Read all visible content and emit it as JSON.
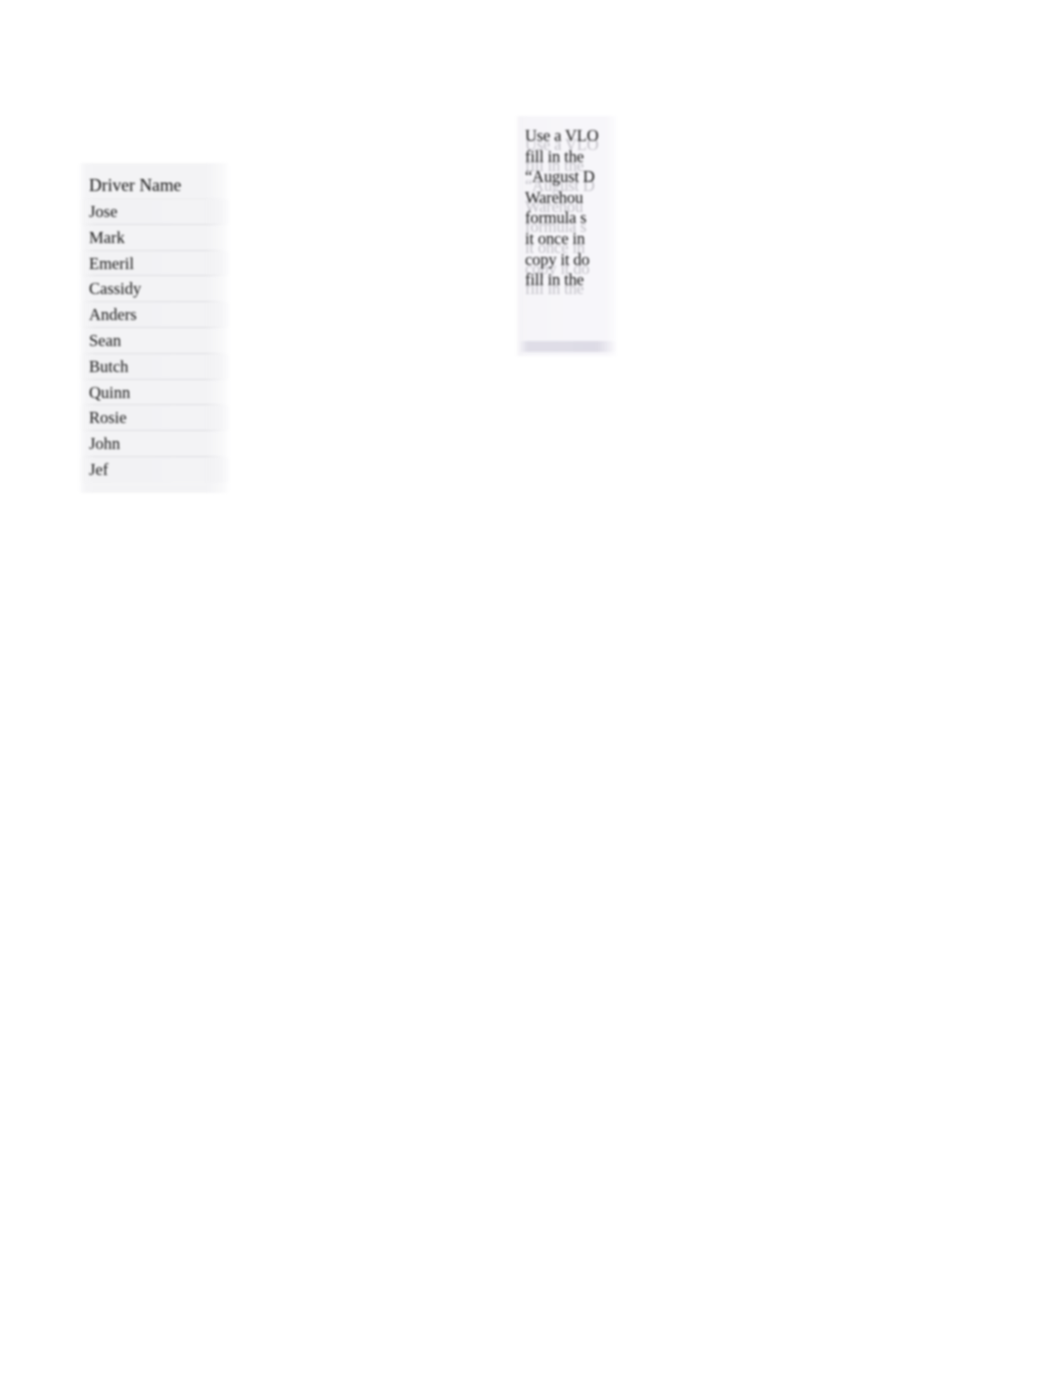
{
  "document": {
    "background_color": "#ffffff",
    "text_color": "#121212"
  },
  "driver_table": {
    "header": "Driver Name",
    "rows": [
      "Jose",
      "Mark",
      "Emeril",
      "Cassidy",
      "Anders",
      "Sean",
      "Butch",
      "Quinn",
      "Rosie",
      "John",
      "Jef"
    ]
  },
  "note_block": {
    "accent_color": "#dbd9e4",
    "lines": [
      "Use a VLO",
      "fill in the",
      "“August D",
      "Warehou",
      "formula s",
      "it once in",
      "copy it do",
      "fill in the"
    ]
  }
}
